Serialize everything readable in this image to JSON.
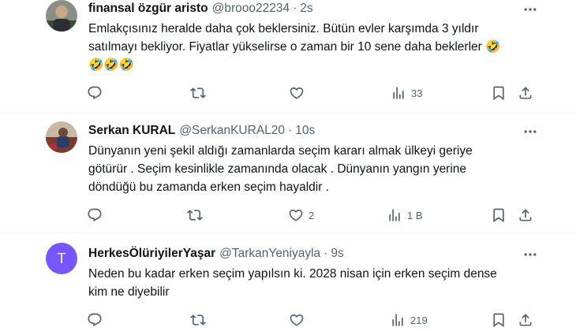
{
  "tweets": [
    {
      "name": "finansal özgür aristo",
      "handle": "@brooo22234",
      "separator": "·",
      "time": "2s",
      "lines": [
        "Emlakçısınız heralde daha çok beklersiniz. Bütün evler karşımda 3 yıldır",
        "satılmayı bekliyor. Fiyatlar yükselirse o zaman bir 10 sene daha beklerler 🤣",
        "🤣🤣🤣"
      ],
      "reply_count": "",
      "retweet_count": "",
      "like_count": "",
      "views_count": "33"
    },
    {
      "name": "Serkan KURAL",
      "handle": "@SerkanKURAL20",
      "separator": "·",
      "time": "10s",
      "lines": [
        "Dünyanın yeni şekil aldığı zamanlarda seçim kararı almak ülkeyi geriye",
        "götürür . Seçim kesinlikle zamanında olacak . Dünyanın yangın yerine",
        "döndüğü bu zamanda erken seçim hayaldir ."
      ],
      "reply_count": "",
      "retweet_count": "",
      "like_count": "2",
      "views_count": "1 B"
    },
    {
      "name": "HerkesÖlüriyilerYaşar",
      "handle": "@TarkanYeniyayla",
      "separator": "·",
      "time": "9s",
      "avatar_letter": "T",
      "lines": [
        "Neden bu kadar erken seçim yapılsın ki. 2028 nisan için erken seçim dense",
        "kim ne diyebilir"
      ],
      "reply_count": "",
      "retweet_count": "",
      "like_count": "",
      "views_count": "219"
    }
  ],
  "icons": [
    "more-icon",
    "reply-icon",
    "retweet-icon",
    "like-icon",
    "views-icon",
    "bookmark-icon",
    "share-icon"
  ],
  "colors": {
    "text": "#0f1419",
    "secondary": "#536471",
    "divider": "#eff3f4",
    "avatar_purple": "#7856ff"
  }
}
